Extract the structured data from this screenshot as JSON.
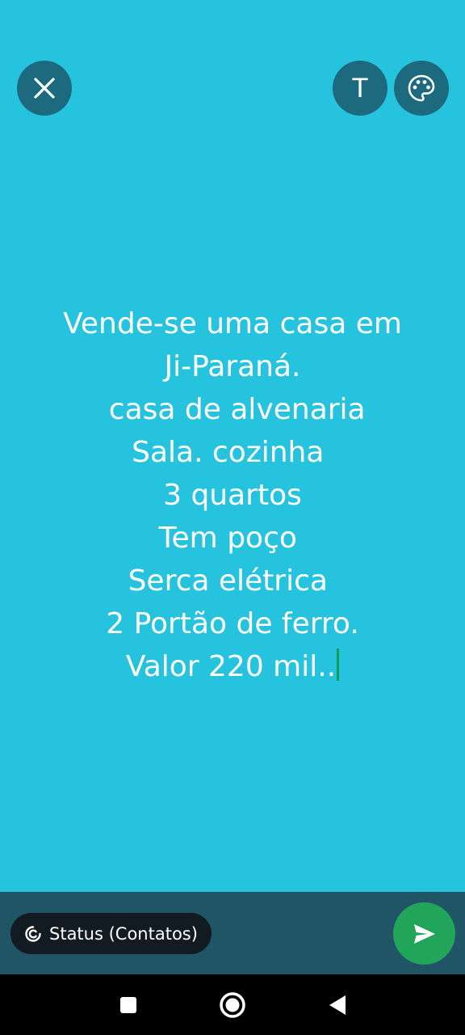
{
  "top_bar": {
    "close_icon": "close-icon",
    "text_button_label": "T",
    "palette_icon": "palette-icon"
  },
  "status": {
    "lines": [
      "Vende-se uma casa em",
      "Ji-Paraná.",
      " casa de alvenaria",
      "Sala. cozinha ",
      "3 quartos",
      "Tem poço ",
      "Serca elétrica ",
      "2 Portão de ferro.",
      "Valor 220 mil.."
    ],
    "background_color": "#26c3df",
    "text_color": "#ffffff",
    "cursor_color": "#0f9d58"
  },
  "bottom_bar": {
    "audience_label": "Status (Contatos)",
    "send_icon": "send-icon",
    "send_color": "#21a55a"
  },
  "nav": {
    "recents_icon": "square-icon",
    "home_icon": "circle-home-icon",
    "back_icon": "triangle-back-icon"
  }
}
